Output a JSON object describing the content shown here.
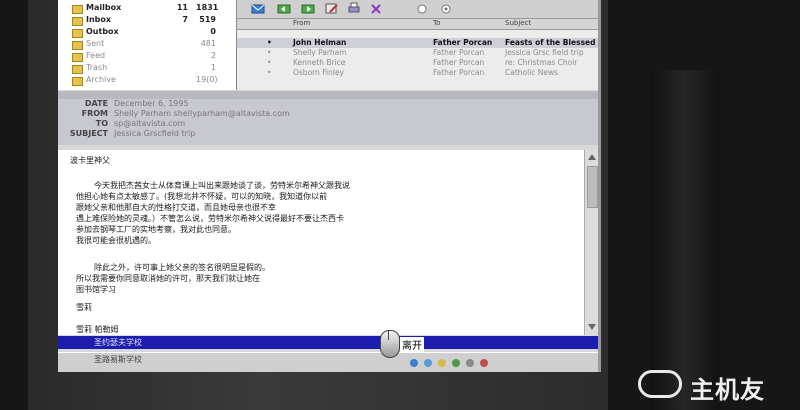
{
  "folders": [
    {
      "name": "Mailbox",
      "count1": "11",
      "count2": "1831",
      "style": "bold"
    },
    {
      "name": "Inbox",
      "count1": "7",
      "count2": "519",
      "style": "bold"
    },
    {
      "name": "Outbox",
      "count1": "",
      "count2": "0",
      "style": "bold"
    },
    {
      "name": "Sent",
      "count1": "",
      "count2": "481",
      "style": "dim"
    },
    {
      "name": "Feed",
      "count1": "",
      "count2": "2",
      "style": "dim"
    },
    {
      "name": "Trash",
      "count1": "",
      "count2": "1",
      "style": "dim"
    },
    {
      "name": "Archive",
      "count1": "",
      "count2": "19(0)",
      "style": "dim"
    }
  ],
  "message_list": {
    "columns": {
      "from": "From",
      "to": "To",
      "subject": "Subject"
    },
    "rows": [
      {
        "from": "John Helman",
        "to": "Father Porcan",
        "subject": "Feasts of the Blessed Virgin Mary",
        "state": "selected"
      },
      {
        "from": "Shelly Parham",
        "to": "Father Porcan",
        "subject": "Jessica Grsc field trip",
        "state": "unselected"
      },
      {
        "from": "Kenneth Brice",
        "to": "Father Porcan",
        "subject": "re: Christmas Choir",
        "state": "unselected"
      },
      {
        "from": "Osborn Finley",
        "to": "Father Porcan",
        "subject": "Catholic News",
        "state": "unselected"
      }
    ]
  },
  "header": {
    "date_label": "DATE",
    "date": "December 6, 1995",
    "from_label": "FROM",
    "from": "Shelly Parham shellyparham@altavista.com",
    "to_label": "TO",
    "to": "sp@altavista.com",
    "subject_label": "SUBJECT",
    "subject": "Jessica Grscfield trip"
  },
  "body_lines": [
    "波卡里神父",
    "今天我把杰茜女士从体育课上叫出来跟她谈了谈，劳特米尔希神父跟我说",
    "他担心她有点太敏感了。(我想北井不怀疑，可以的知晓，我知道你以前",
    "跟她父亲和他那自大的性格打交道，而且她母亲也很不幸",
    "遇上难保险她的灵魂。）不管怎么说，劳特米尔希神父说得最好不要让杰西卡",
    "参加去钢琴工厂的实地考察，我对此也同意。",
    "我很可能会很机遇的。",
    "",
    "除此之外，许可事上她父亲的签名很明显是假的。",
    "所以我需要你同意取消她的许可，那天我们就让她在",
    "图书馆学习",
    "",
    "雪莉",
    "",
    "雪莉 帕勒姆",
    "圣约瑟夫学校",
    "圣路易斯学校"
  ],
  "cursor_label": "离开",
  "watermark": "主机友",
  "colors": {
    "accent": "#1c1cae",
    "header_bg": "#c8c8d0",
    "folder_icon": "#e6c34a"
  }
}
